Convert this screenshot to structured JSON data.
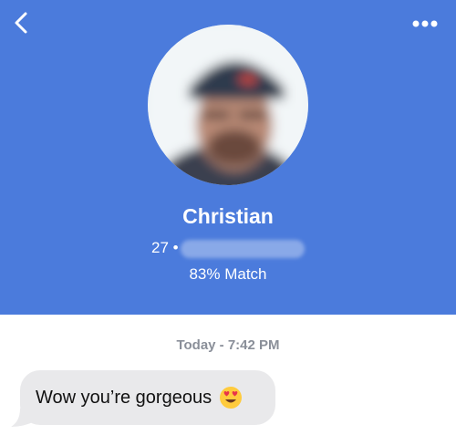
{
  "profile": {
    "name": "Christian",
    "age": "27 •",
    "match": "83% Match"
  },
  "chat": {
    "timestamp": "Today - 7:42 PM",
    "messages": [
      {
        "text": "Wow you’re gorgeous",
        "emoji": "heart-eyes-emoji"
      }
    ]
  },
  "icons": {
    "back": "chevron-left-icon",
    "more": "more-options-icon"
  },
  "colors": {
    "header": "#4b7bdc",
    "bubble": "#e9e9eb",
    "timestamp": "#8a8f99"
  }
}
